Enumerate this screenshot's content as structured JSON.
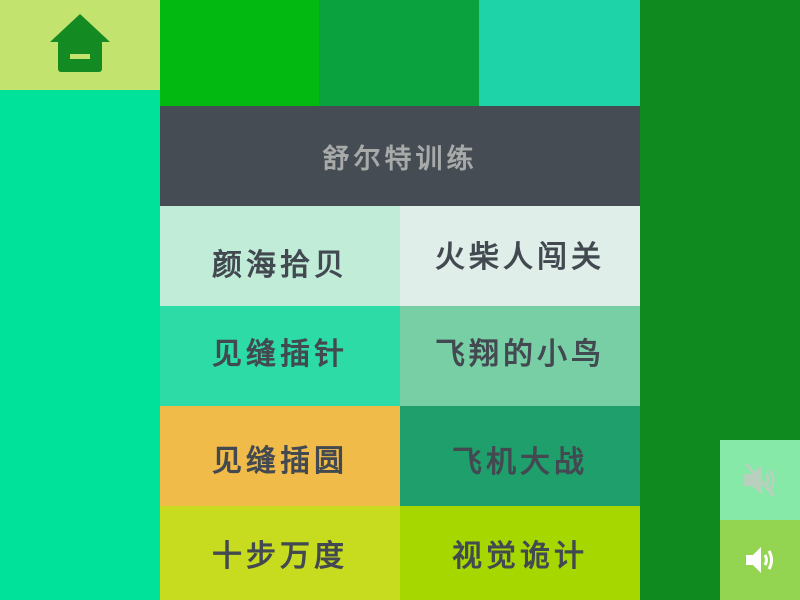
{
  "header": {
    "home_icon": "home-icon",
    "title": "舒尔特训练"
  },
  "games": [
    {
      "label": "颜海拾贝",
      "bg": "#c0ecd8"
    },
    {
      "label": "火柴人闯关",
      "bg": "#dfeee9"
    },
    {
      "label": "见缝插针",
      "bg": "#2cdba5"
    },
    {
      "label": "飞翔的小鸟",
      "bg": "#78cfa5"
    },
    {
      "label": "见缝插圆",
      "bg": "#f1bb4a"
    },
    {
      "label": "飞机大战",
      "bg": "#1e9f6b"
    },
    {
      "label": "十步万度",
      "bg": "#c8dc1f"
    },
    {
      "label": "视觉诡计",
      "bg": "#a6d800"
    }
  ],
  "sound": {
    "mute_icon": "speaker-muted-icon",
    "on_icon": "speaker-on-icon"
  },
  "colors": {
    "home_block": "#c2e46e",
    "left_panel": "#00e29a",
    "top_tab_1": "#02b912",
    "top_tab_2": "#0aa23f",
    "top_tab_3": "#1dd3a7",
    "right_strip": "#0f8a1f",
    "title_bar": "#464c54",
    "home_icon": "#138a22"
  }
}
